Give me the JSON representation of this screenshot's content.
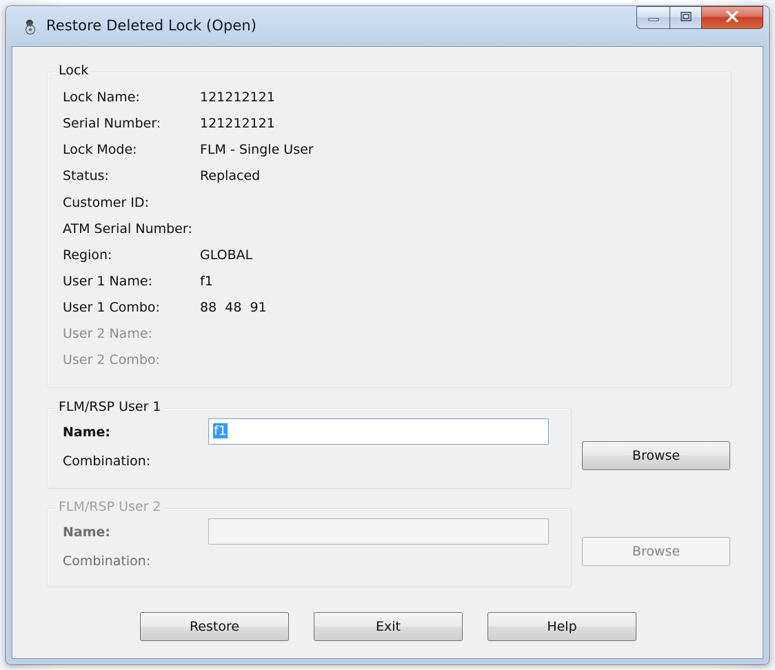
{
  "window": {
    "title": "Restore Deleted Lock (Open)"
  },
  "lock_group": {
    "title": "Lock",
    "rows": [
      {
        "label": "Lock Name:",
        "value": "121212121"
      },
      {
        "label": "Serial Number:",
        "value": "121212121"
      },
      {
        "label": "Lock Mode:",
        "value": "FLM - Single User"
      },
      {
        "label": "Status:",
        "value": "Replaced"
      },
      {
        "label": "Customer ID:",
        "value": ""
      },
      {
        "label": "ATM Serial Number:",
        "value": ""
      },
      {
        "label": "Region:",
        "value": "GLOBAL"
      },
      {
        "label": "User 1 Name:",
        "value": "f1"
      },
      {
        "label": "User 1 Combo:",
        "value": "88  48  91"
      },
      {
        "label": "User 2 Name:",
        "value": ""
      },
      {
        "label": "User 2 Combo:",
        "value": ""
      }
    ]
  },
  "user1_group": {
    "title": "FLM/RSP User 1",
    "name_label": "Name:",
    "name_value": "f1",
    "combination_label": "Combination:",
    "browse_label": "Browse"
  },
  "user2_group": {
    "title": "FLM/RSP User 2",
    "name_label": "Name:",
    "name_value": "",
    "combination_label": "Combination:",
    "browse_label": "Browse"
  },
  "buttons": {
    "restore": "Restore",
    "exit": "Exit",
    "help": "Help"
  },
  "icons": {
    "app": "lock-dial-icon",
    "minimize": "minimize-icon",
    "maximize": "maximize-icon",
    "close": "close-icon"
  }
}
